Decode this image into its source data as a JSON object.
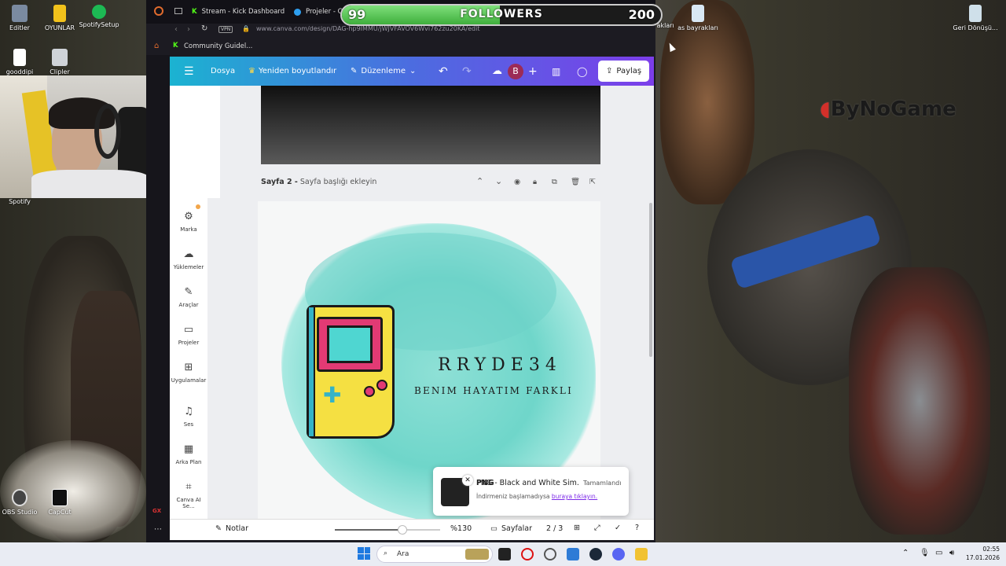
{
  "desktop": {
    "icons": [
      {
        "label": "Editler"
      },
      {
        "label": "OYUNLAR"
      },
      {
        "label": "SpotifySetup"
      },
      {
        "label": "gooddipi"
      },
      {
        "label": "Clipler"
      },
      {
        "label": "Spotify"
      },
      {
        "label": "OBS Studio"
      },
      {
        "label": "CapCut"
      },
      {
        "label": "rakları"
      },
      {
        "label": "as bayrakları"
      },
      {
        "label": "Geri Dönüşü..."
      }
    ],
    "watermark": "ByNoGame"
  },
  "followers_goal": {
    "current": "99",
    "label": "FOLLOWERS",
    "target": "200",
    "progress": 0.495
  },
  "browser": {
    "tabs": [
      {
        "label": "Stream - Kick Dashboard"
      },
      {
        "label": "Projeler - C"
      }
    ],
    "vpn_badge": "VPN",
    "url": "www.canva.com/design/DAG-hp9IMMU/jWJVFAVOV6Wvi762zu20KA/edit",
    "bookmark": "Community Guidel..."
  },
  "canva": {
    "toolbar": {
      "file": "Dosya",
      "resize": "Yeniden boyutlandır",
      "edit": "Düzenleme",
      "avatar": "B",
      "share": "Paylaş"
    },
    "nav": [
      {
        "label": "Marka",
        "icon": "brand-icon"
      },
      {
        "label": "Yüklemeler",
        "icon": "upload-icon"
      },
      {
        "label": "Araçlar",
        "icon": "tools-icon"
      },
      {
        "label": "Projeler",
        "icon": "folder-icon"
      },
      {
        "label": "Uygulamalar",
        "icon": "apps-icon"
      },
      {
        "label": "Ses",
        "icon": "music-icon"
      },
      {
        "label": "Arka Plan",
        "icon": "background-icon"
      },
      {
        "label": "Canva AI Se...",
        "icon": "ai-icon"
      }
    ],
    "page_header": {
      "page": "Sayfa 2 -",
      "title_placeholder": "Sayfa başlığı ekleyin"
    },
    "design": {
      "title": "RRYDE34",
      "subtitle": "BENIM HAYATIM FARKLI"
    },
    "toast": {
      "title": "PNG - Black and White Sim...",
      "status": "Tamamlandı",
      "message": "İndirmeniz başlamadıysa",
      "link": "buraya tıklayın."
    },
    "bottom": {
      "notes": "Notlar",
      "zoom": "%130",
      "zoom_fraction": 0.64,
      "pages_label": "Sayfalar",
      "page_count": "2 / 3"
    }
  },
  "taskbar": {
    "search": "Ara",
    "time": "02:55",
    "date": "17.01.2026"
  }
}
